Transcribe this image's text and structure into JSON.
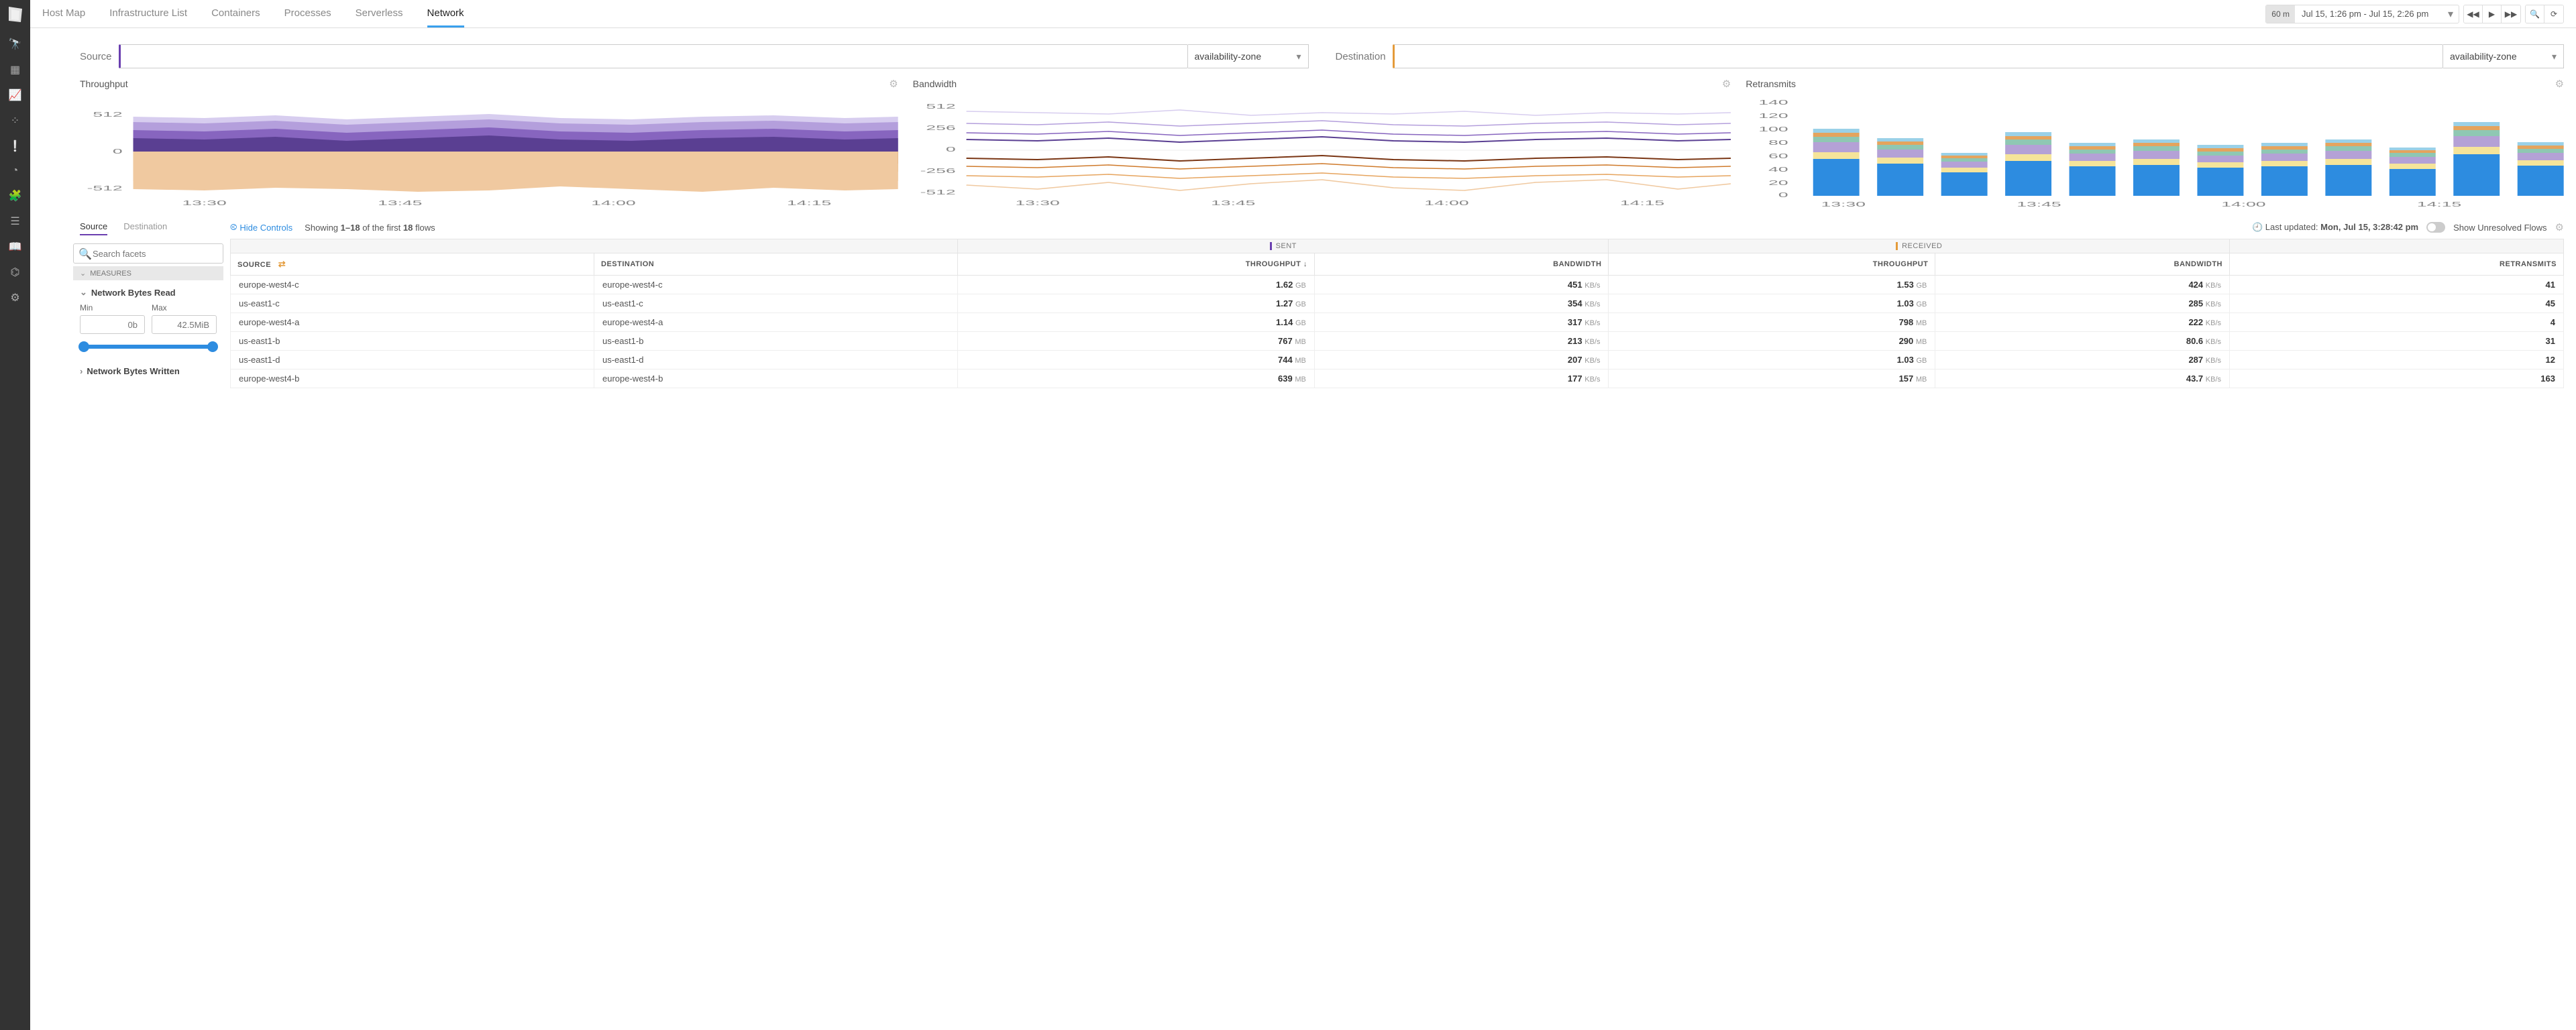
{
  "nav": {
    "items": [
      "Host Map",
      "Infrastructure List",
      "Containers",
      "Processes",
      "Serverless",
      "Network"
    ],
    "active": 5
  },
  "time": {
    "preset": "60 m",
    "range": "Jul 15, 1:26 pm - Jul 15, 2:26 pm"
  },
  "filters": {
    "source_label": "Source",
    "dest_label": "Destination",
    "dropdown": "availability-zone"
  },
  "charts": {
    "throughput": {
      "title": "Throughput",
      "yticks": [
        "512",
        "0",
        "-512"
      ],
      "xticks": [
        "13:30",
        "13:45",
        "14:00",
        "14:15"
      ]
    },
    "bandwidth": {
      "title": "Bandwidth",
      "yticks": [
        "512",
        "256",
        "0",
        "-256",
        "-512"
      ],
      "xticks": [
        "13:30",
        "13:45",
        "14:00",
        "14:15"
      ]
    },
    "retransmits": {
      "title": "Retransmits",
      "yticks": [
        "140",
        "120",
        "100",
        "80",
        "60",
        "40",
        "20",
        "0"
      ],
      "xticks": [
        "13:30",
        "13:45",
        "14:00",
        "14:15"
      ]
    }
  },
  "chart_data": [
    {
      "type": "area",
      "name": "Throughput",
      "ylim": [
        -512,
        512
      ],
      "x": [
        "13:30",
        "13:45",
        "14:00",
        "14:15"
      ],
      "series_pos": [
        510,
        500,
        495,
        505,
        490,
        520,
        500,
        495,
        510,
        500,
        495,
        505
      ],
      "series_neg": [
        -480,
        -470,
        -490,
        -460,
        -500,
        -470,
        -490,
        -480,
        -470,
        -490,
        -460,
        -500
      ],
      "palette": [
        "#c7b9e8",
        "#a78ed2",
        "#7d5eb6",
        "#5a3f92",
        "#f0c9a0",
        "#e6a45e",
        "#cf7a2b",
        "#9c4d1c"
      ]
    },
    {
      "type": "line",
      "name": "Bandwidth",
      "ylim": [
        -512,
        512
      ],
      "x": [
        "13:30",
        "13:45",
        "14:00",
        "14:15"
      ],
      "series": [
        {
          "name": "s1",
          "color": "#5a3f92",
          "values": [
            310,
            300,
            290,
            295,
            280,
            300,
            295,
            290,
            300,
            295,
            285,
            295
          ]
        },
        {
          "name": "s2",
          "color": "#a78ed2",
          "values": [
            260,
            255,
            250,
            258,
            248,
            260,
            254,
            250,
            258,
            252,
            246,
            254
          ]
        },
        {
          "name": "s3",
          "color": "#d0c4ea",
          "values": [
            180,
            175,
            170,
            178,
            168,
            182,
            176,
            172,
            178,
            170,
            165,
            172
          ]
        },
        {
          "name": "s4",
          "color": "#e6a45e",
          "values": [
            -280,
            -270,
            -290,
            -260,
            -300,
            -275,
            -290,
            -280,
            -268,
            -292,
            -260,
            -300
          ]
        },
        {
          "name": "s5",
          "color": "#cf7a2b",
          "values": [
            -210,
            -205,
            -215,
            -200,
            -225,
            -208,
            -218,
            -210,
            -202,
            -220,
            -200,
            -225
          ]
        },
        {
          "name": "s6",
          "color": "#9c4d1c",
          "values": [
            -140,
            -135,
            -150,
            -130,
            -160,
            -145,
            -150,
            -140,
            -132,
            -155,
            -130,
            -160
          ]
        }
      ]
    },
    {
      "type": "bar",
      "name": "Retransmits",
      "ylim": [
        0,
        140
      ],
      "categories": [
        "13:30",
        "",
        "13:45",
        "",
        "14:00",
        "",
        "14:15",
        ""
      ],
      "stacks": [
        "#2d8ce0",
        "#f5e49a",
        "#b4a1d6",
        "#8fc7b3",
        "#e4a45e",
        "#9ad1e8"
      ],
      "values": [
        [
          55,
          10,
          15,
          8,
          6,
          6
        ],
        [
          48,
          9,
          12,
          7,
          5,
          5
        ],
        [
          35,
          7,
          9,
          5,
          4,
          4
        ],
        [
          52,
          10,
          14,
          8,
          5,
          6
        ],
        [
          44,
          8,
          11,
          6,
          5,
          5
        ],
        [
          46,
          9,
          12,
          7,
          5,
          5
        ],
        [
          42,
          8,
          10,
          6,
          5,
          5
        ],
        [
          44,
          8,
          11,
          6,
          5,
          5
        ],
        [
          46,
          9,
          12,
          7,
          5,
          5
        ],
        [
          40,
          8,
          10,
          6,
          4,
          4
        ],
        [
          62,
          11,
          16,
          9,
          6,
          6
        ],
        [
          45,
          8,
          11,
          6,
          5,
          5
        ]
      ]
    }
  ],
  "facet_tabs": {
    "source": "Source",
    "dest": "Destination"
  },
  "hide_controls": "Hide Controls",
  "search_placeholder": "Search facets",
  "measures_label": "MEASURES",
  "facet_bytes_read": "Network Bytes Read",
  "facet_bytes_written": "Network Bytes Written",
  "min_label": "Min",
  "max_label": "Max",
  "min_ph": "0b",
  "max_ph": "42.5MiB",
  "showing": {
    "prefix": "Showing ",
    "range": "1–18",
    "mid": " of the first ",
    "total": "18",
    "suffix": " flows"
  },
  "updated": {
    "label": "Last updated: ",
    "time": "Mon, Jul 15, 3:28:42 pm"
  },
  "unresolved": "Show Unresolved Flows",
  "headers": {
    "source": "SOURCE",
    "dest": "DESTINATION",
    "sent": "SENT",
    "recv": "RECEIVED",
    "throughput": "THROUGHPUT",
    "bandwidth": "BANDWIDTH",
    "retrans": "RETRANSMITS"
  },
  "rows": [
    {
      "src": "europe-west4-c",
      "dst": "europe-west4-c",
      "s_tp": "1.62",
      "s_tp_u": "GB",
      "s_bw": "451",
      "s_bw_u": "KB/s",
      "r_tp": "1.53",
      "r_tp_u": "GB",
      "r_bw": "424",
      "r_bw_u": "KB/s",
      "rt": "41"
    },
    {
      "src": "us-east1-c",
      "dst": "us-east1-c",
      "s_tp": "1.27",
      "s_tp_u": "GB",
      "s_bw": "354",
      "s_bw_u": "KB/s",
      "r_tp": "1.03",
      "r_tp_u": "GB",
      "r_bw": "285",
      "r_bw_u": "KB/s",
      "rt": "45"
    },
    {
      "src": "europe-west4-a",
      "dst": "europe-west4-a",
      "s_tp": "1.14",
      "s_tp_u": "GB",
      "s_bw": "317",
      "s_bw_u": "KB/s",
      "r_tp": "798",
      "r_tp_u": "MB",
      "r_bw": "222",
      "r_bw_u": "KB/s",
      "rt": "4"
    },
    {
      "src": "us-east1-b",
      "dst": "us-east1-b",
      "s_tp": "767",
      "s_tp_u": "MB",
      "s_bw": "213",
      "s_bw_u": "KB/s",
      "r_tp": "290",
      "r_tp_u": "MB",
      "r_bw": "80.6",
      "r_bw_u": "KB/s",
      "rt": "31"
    },
    {
      "src": "us-east1-d",
      "dst": "us-east1-d",
      "s_tp": "744",
      "s_tp_u": "MB",
      "s_bw": "207",
      "s_bw_u": "KB/s",
      "r_tp": "1.03",
      "r_tp_u": "GB",
      "r_bw": "287",
      "r_bw_u": "KB/s",
      "rt": "12"
    },
    {
      "src": "europe-west4-b",
      "dst": "europe-west4-b",
      "s_tp": "639",
      "s_tp_u": "MB",
      "s_bw": "177",
      "s_bw_u": "KB/s",
      "r_tp": "157",
      "r_tp_u": "MB",
      "r_bw": "43.7",
      "r_bw_u": "KB/s",
      "rt": "163"
    }
  ]
}
